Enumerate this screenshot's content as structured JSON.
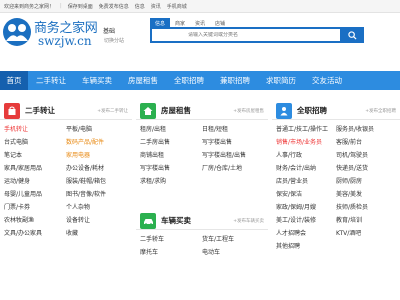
{
  "topbar": {
    "welcome": "欢迎来到商务之家网！",
    "links": [
      "保存到桌面",
      "免费发布信息",
      "信息",
      "资讯",
      "手机商城"
    ]
  },
  "logo": {
    "cn": "商务之家网",
    "en": "swzjw.cn"
  },
  "city": {
    "name": "基础",
    "switch": "切换分站"
  },
  "search": {
    "tabs": [
      "信息",
      "商家",
      "资讯",
      "店铺"
    ],
    "placeholder": "请输入关键词或分类名"
  },
  "nav": {
    "home": "首页",
    "items": [
      "二手转让",
      "车辆买卖",
      "房屋租售",
      "全职招聘",
      "兼职招聘",
      "求职简历",
      "交友活动"
    ]
  },
  "panels": {
    "secondhand": {
      "title": "二手转让",
      "post": "+发布二手转让",
      "items": [
        "手机转让",
        "平板/电脑",
        "台式电脑",
        "数码产品/配件",
        "笔记本",
        "家用电器",
        "家具/家居用品",
        "办公设备/耗材",
        "运动/健身",
        "服装/鞋帽/箱包",
        "母婴/儿童用品",
        "图书/音像/软件",
        "门票/卡券",
        "个人杂物",
        "农林牧副渔",
        "设备转让",
        "文具/办公家具",
        "收藏"
      ]
    },
    "house": {
      "title": "房屋租售",
      "post": "+发布房屋租售",
      "items": [
        "租房/出租",
        "日租/短租",
        "二手房出售",
        "写字楼出售",
        "商铺出租",
        "写字楼出租/出售",
        "写字楼出售",
        "厂房/仓库/土地",
        "求租/求购",
        ""
      ]
    },
    "car": {
      "title": "车辆买卖",
      "post": "+发布车辆买卖",
      "items": [
        "二手轿车",
        "货车/工程车",
        "摩托车",
        "电动车"
      ]
    },
    "jobs": {
      "title": "全职招聘",
      "post": "+发布全职招聘",
      "items": [
        "普通工/技工/操作工",
        "服务员/收银员",
        "销售/市场/业务员",
        "客服/前台",
        "人事/行政",
        "司机/驾驶员",
        "财务/会计/出纳",
        "快递员/送货",
        "店员/营业员",
        "厨师/厨房",
        "保安/保洁",
        "美容/美发",
        "家政/保姆/月嫂",
        "技师/质检员",
        "美工/设计/装修",
        "教育/培训",
        "人才招聘会",
        "KTV/酒吧",
        "其他招聘",
        ""
      ]
    }
  }
}
